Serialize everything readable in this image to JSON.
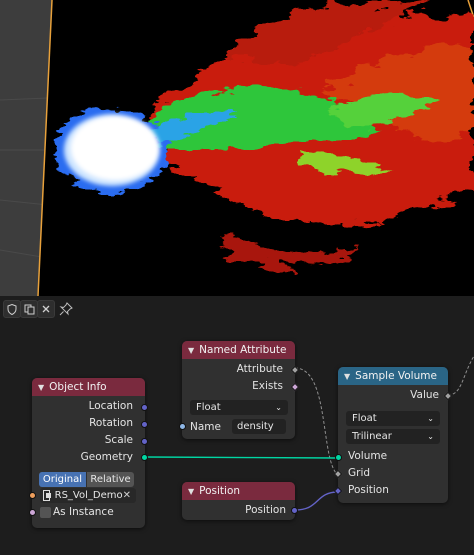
{
  "viewport": {
    "colors": {
      "background": "#3d3d3d",
      "volume_black": "#000000",
      "volume_red": "#d21f0e",
      "volume_green": "#2fd33a",
      "volume_blue": "#2a6cf0",
      "volume_white": "#ffffff",
      "bounds": "#e8a13b"
    }
  },
  "editor_header": {
    "icons": [
      "shield-icon",
      "copy-icon",
      "close-icon",
      "pin-icon"
    ]
  },
  "nodes": {
    "named_attribute": {
      "title": "Named Attribute",
      "outputs": [
        "Attribute",
        "Exists"
      ],
      "type_dropdown": "Float",
      "name_label": "Name",
      "name_value": "density",
      "header_color": "#7a2a3e"
    },
    "object_info": {
      "title": "Object Info",
      "outputs": [
        "Location",
        "Rotation",
        "Scale",
        "Geometry"
      ],
      "toggle_original": "Original",
      "toggle_relative": "Relative",
      "object_value": "RS_Vol_Demo",
      "as_instance_label": "As Instance",
      "header_color": "#7a2a3e"
    },
    "position": {
      "title": "Position",
      "output": "Position",
      "header_color": "#7a2a3e"
    },
    "sample_volume": {
      "title": "Sample Volume",
      "output": "Value",
      "data_type_dropdown": "Float",
      "interpolation_dropdown": "Trilinear",
      "inputs": [
        "Volume",
        "Grid",
        "Position"
      ],
      "header_color": "#2a6586"
    }
  },
  "socket_colors": {
    "float": "#a1a1a1",
    "vector": "#6363c7",
    "geometry": "#00d6a3",
    "bool": "#cca6d6",
    "object": "#ed9e5c"
  }
}
